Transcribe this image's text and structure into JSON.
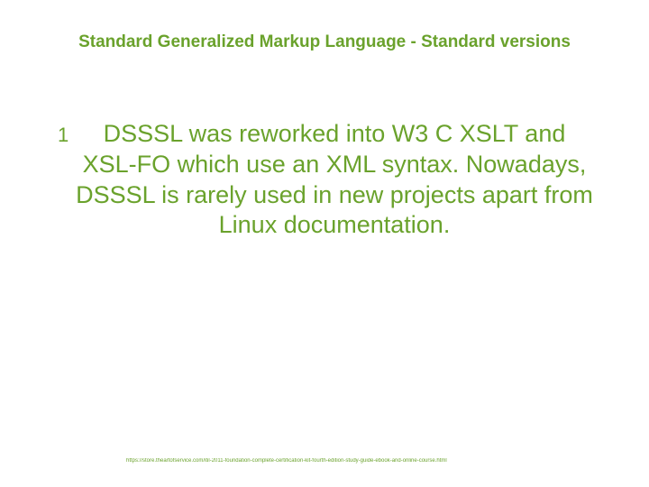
{
  "slide": {
    "title": "Standard Generalized Markup Language - Standard versions",
    "bullet_number": "1",
    "body": "DSSSL was reworked into W3 C XSLT and XSL-FO which use an XML syntax. Nowadays, DSSSL is rarely used in new projects apart from Linux documentation.",
    "footer": "https://store.theartofservice.com/itil-2011-foundation-complete-certification-kit-fourth-edition-study-guide-ebook-and-online-course.html"
  }
}
